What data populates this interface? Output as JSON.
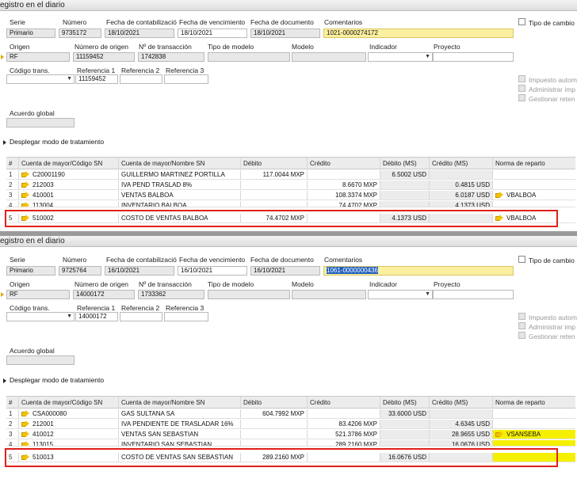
{
  "panels": [
    {
      "title": "egistro en el diario",
      "labels": {
        "serie": "Serie",
        "numero": "Número",
        "fecha_cont": "Fecha de contabilizació",
        "fecha_venc": "Fecha de vencimiento",
        "fecha_doc": "Fecha de documento",
        "comentarios": "Comentarios",
        "origen": "Origen",
        "num_origen": "Número de origen",
        "num_trans": "Nº de transacción",
        "tipo_modelo": "Tipo de modelo",
        "modelo": "Modelo",
        "indicador": "Indicador",
        "proyecto": "Proyecto",
        "codigo_trans": "Código trans.",
        "ref1": "Referencia 1",
        "ref2": "Referencia 2",
        "ref3": "Referencia 3",
        "acuerdo": "Acuerdo global",
        "tipo_cambio": "Tipo de cambio",
        "impuesto": "Impuesto autom",
        "administrar": "Administrar imp",
        "gestionar": "Gestionar reten",
        "desplegar": "Desplegar modo de tratamiento"
      },
      "values": {
        "serie": "Primario",
        "numero": "9735172",
        "fecha_cont": "18/10/2021",
        "fecha_venc": "18/10/2021",
        "fecha_doc": "18/10/2021",
        "comentarios": "1021-0000274172",
        "origen": "RF",
        "num_origen": "11159452",
        "num_trans": "1742838",
        "ref1": "11159452"
      },
      "grid": {
        "headers": [
          "#",
          "Cuenta de mayor/Código SN",
          "Cuenta de mayor/Nombre SN",
          "Débito",
          "Crédito",
          "Débito (MS)",
          "Crédito (MS)",
          "Norma de reparto"
        ],
        "rows": [
          {
            "n": "1",
            "code": "C20001190",
            "name": "GUILLERMO MARTINEZ PORTILLA",
            "debito": "117.0044 MXP",
            "credito": "",
            "debito_ms": "6.5002 USD",
            "credito_ms": "",
            "norma": ""
          },
          {
            "n": "2",
            "code": "212003",
            "name": "IVA PEND TRASLAD 8%",
            "debito": "",
            "credito": "8.6670 MXP",
            "debito_ms": "",
            "credito_ms": "0.4815 USD",
            "norma": ""
          },
          {
            "n": "3",
            "code": "410001",
            "name": "VENTAS BALBOA",
            "debito": "",
            "credito": "108.3374 MXP",
            "debito_ms": "",
            "credito_ms": "6.0187 USD",
            "norma": "VBALBOA"
          },
          {
            "n": "4",
            "code": "113004",
            "name": "INVENTARIO BALBOA",
            "debito": "",
            "credito": "74.4702 MXP",
            "debito_ms": "",
            "credito_ms": "4.1373 USD",
            "norma": ""
          },
          {
            "n": "5",
            "code": "510002",
            "name": "COSTO DE VENTAS BALBOA",
            "debito": "74.4702 MXP",
            "credito": "",
            "debito_ms": "4.1373 USD",
            "credito_ms": "",
            "norma": "VBALBOA"
          }
        ]
      }
    },
    {
      "title": "egistro en el diario",
      "labels": {
        "serie": "Serie",
        "numero": "Número",
        "fecha_cont": "Fecha de contabilizació",
        "fecha_venc": "Fecha de vencimiento",
        "fecha_doc": "Fecha de documento",
        "comentarios": "Comentarios",
        "origen": "Origen",
        "num_origen": "Número de origen",
        "num_trans": "Nº de transacción",
        "tipo_modelo": "Tipo de modelo",
        "modelo": "Modelo",
        "indicador": "Indicador",
        "proyecto": "Proyecto",
        "codigo_trans": "Código trans.",
        "ref1": "Referencia 1",
        "ref2": "Referencia 2",
        "ref3": "Referencia 3",
        "acuerdo": "Acuerdo global",
        "tipo_cambio": "Tipo de cambio",
        "impuesto": "Impuesto autom",
        "administrar": "Administrar imp",
        "gestionar": "Gestionar reten",
        "desplegar": "Desplegar modo de tratamiento"
      },
      "values": {
        "serie": "Primario",
        "numero": "9725764",
        "fecha_cont": "16/10/2021",
        "fecha_venc": "16/10/2021",
        "fecha_doc": "16/10/2021",
        "comentarios": "1061-0000000436",
        "origen": "RF",
        "num_origen": "14000172",
        "num_trans": "1733362",
        "ref1": "14000172"
      },
      "grid": {
        "headers": [
          "#",
          "Cuenta de mayor/Código SN",
          "Cuenta de mayor/Nombre SN",
          "Débito",
          "Crédito",
          "Débito (MS)",
          "Crédito (MS)",
          "Norma de reparto"
        ],
        "rows": [
          {
            "n": "1",
            "code": "CSA000080",
            "name": "GAS SULTANA SA",
            "debito": "604.7992 MXP",
            "credito": "",
            "debito_ms": "33.6000 USD",
            "credito_ms": "",
            "norma": ""
          },
          {
            "n": "2",
            "code": "212001",
            "name": "IVA PENDIENTE DE TRASLADAR 16%",
            "debito": "",
            "credito": "83.4206 MXP",
            "debito_ms": "",
            "credito_ms": "4.6345 USD",
            "norma": ""
          },
          {
            "n": "3",
            "code": "410012",
            "name": "VENTAS SAN SEBASTIAN",
            "debito": "",
            "credito": "521.3786 MXP",
            "debito_ms": "",
            "credito_ms": "28.9655 USD",
            "norma": "VSANSEBA"
          },
          {
            "n": "4",
            "code": "113015",
            "name": "INVENTARIO SAN SEBASTIAN",
            "debito": "",
            "credito": "289.2160 MXP",
            "debito_ms": "",
            "credito_ms": "16.0676 USD",
            "norma": ""
          },
          {
            "n": "5",
            "code": "510013",
            "name": "COSTO DE VENTAS SAN SEBASTIAN",
            "debito": "289.2160 MXP",
            "credito": "",
            "debito_ms": "16.0676 USD",
            "credito_ms": "",
            "norma": ""
          }
        ]
      }
    }
  ],
  "colors": {
    "highlight_box": "#e0201a",
    "comment_field": "#fbf0a0",
    "yellow_mark": "#f5f000",
    "link_arrow": "#f3c200"
  }
}
